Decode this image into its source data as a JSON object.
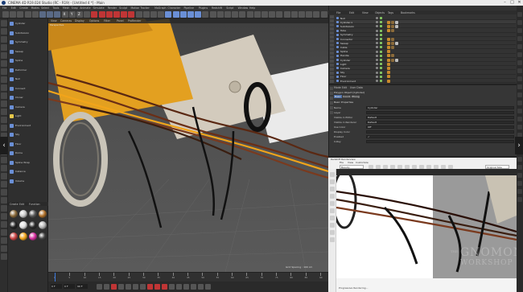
{
  "window": {
    "title": "CINEMA 4D R19.024 Studio (RC - R19) - [Untitled 4 *] - Main",
    "controls": [
      "–",
      "□",
      "✕"
    ]
  },
  "menubar": {
    "items": [
      "File",
      "Edit",
      "Create",
      "Modes",
      "Select",
      "Tools",
      "Mesh",
      "Snap",
      "Animate",
      "Simulate",
      "Render",
      "Sculpt",
      "Motion Tracker",
      "MoGraph",
      "Character",
      "Pipeline",
      "Plugins",
      "Redshift",
      "Script",
      "Window",
      "Help"
    ],
    "layout_label": "Layout:",
    "layout_value": "Startup (User)"
  },
  "toolbar": {
    "axis_labels": [
      "X",
      "Y",
      "Z"
    ]
  },
  "browser": {
    "items": [
      {
        "label": "Cylinder",
        "color": "#6a8fd6"
      },
      {
        "label": "Subdivision",
        "color": "#6a8fd6"
      },
      {
        "label": "Symmetry",
        "color": "#6a8fd6"
      },
      {
        "label": "Sweep",
        "color": "#6a8fd6"
      },
      {
        "label": "Spline",
        "color": "#6a8fd6"
      },
      {
        "label": "Deformer",
        "color": "#6a8fd6"
      },
      {
        "label": "Null",
        "color": "#6a8fd6"
      },
      {
        "label": "Connect",
        "color": "#6a8fd6"
      },
      {
        "label": "Cloner",
        "color": "#6a8fd6"
      },
      {
        "label": "Camera",
        "color": "#6a8fd6"
      },
      {
        "label": "Light",
        "color": "#e6c74a"
      },
      {
        "label": "Environment",
        "color": "#6a8fd6"
      },
      {
        "label": "Sky",
        "color": "#6a8fd6"
      },
      {
        "label": "Floor",
        "color": "#6a8fd6"
      },
      {
        "label": "Dome",
        "color": "#6a8fd6"
      },
      {
        "label": "Spline Wrap",
        "color": "#6a8fd6"
      },
      {
        "label": "Instance",
        "color": "#6a8fd6"
      },
      {
        "label": "Volume",
        "color": "#6a8fd6"
      }
    ],
    "materials_header": [
      "Create",
      "Edit",
      "Function"
    ],
    "materials": [
      {
        "color": "#8a6a3a"
      },
      {
        "color": "#c9c9c9"
      },
      {
        "color": "#5a5a5a"
      },
      {
        "color": "#b0712a"
      },
      {
        "color": "#222"
      },
      {
        "color": "#e0e0e0"
      },
      {
        "color": "#2b2b2b"
      },
      {
        "color": "#b7b7b7"
      },
      {
        "color": "#c44"
      },
      {
        "color": "#f2a51a"
      },
      {
        "color": "#d82fa0"
      },
      {
        "color": "#444"
      }
    ]
  },
  "viewport": {
    "menu": [
      "View",
      "Cameras",
      "Display",
      "Options",
      "Filter",
      "Panel",
      "ProRender"
    ],
    "perspective_label": "Perspective",
    "grid_spacing": "Grid Spacing : 100 cm",
    "colors": {
      "orange": "#e09a18",
      "beige": "#d7d0c2",
      "white": "#ececec",
      "wire": "#7a3a1e"
    }
  },
  "timeline": {
    "ticks": [
      "0",
      "5",
      "10",
      "15",
      "20",
      "25",
      "30",
      "35",
      "40",
      "45",
      "50",
      "55",
      "60",
      "65",
      "70",
      "75",
      "80",
      "85",
      "90"
    ],
    "frame_start": "0 F",
    "frame_end": "90 F",
    "current": "0 F"
  },
  "objects": {
    "tabs": [
      "File",
      "Edit",
      "View",
      "Objects",
      "Tags",
      "Bookmarks"
    ],
    "rows": [
      {
        "name": "Null",
        "tags": 0
      },
      {
        "name": "Cylinder.1",
        "tags": 3
      },
      {
        "name": "Subdivision",
        "tags": 3
      },
      {
        "name": "Tube",
        "tags": 2
      },
      {
        "name": "Symmetry",
        "tags": 0
      },
      {
        "name": "Connector",
        "tags": 2
      },
      {
        "name": "Sweep",
        "tags": 3
      },
      {
        "name": "Cable",
        "tags": 2
      },
      {
        "name": "Spline",
        "tags": 1
      },
      {
        "name": "Handle",
        "tags": 2
      },
      {
        "name": "Cylinder",
        "tags": 3
      },
      {
        "name": "Light",
        "tags": 1
      },
      {
        "name": "Camera",
        "tags": 1
      },
      {
        "name": "Sky",
        "tags": 1
      },
      {
        "name": "Floor",
        "tags": 1
      },
      {
        "name": "Environment",
        "tags": 1
      }
    ]
  },
  "attributes": {
    "tabs": [
      "Mode",
      "Edit",
      "User Data"
    ],
    "object_title": "Polygon Object [Cylinder]",
    "subtabs": [
      "Basic",
      "Coord.",
      "Phong"
    ],
    "section": "Basic Properties",
    "rows": [
      {
        "label": "Name",
        "value": "Cylinder"
      },
      {
        "label": "Layer",
        "value": ""
      },
      {
        "label": "Visible in Editor",
        "value": "Default"
      },
      {
        "label": "Visible in Renderer",
        "value": "Default"
      },
      {
        "label": "Use Color",
        "value": "Off"
      },
      {
        "label": "Display Color",
        "value": ""
      },
      {
        "label": "Enabled",
        "value": "✓"
      },
      {
        "label": "X-Ray",
        "value": ""
      }
    ]
  },
  "render_view": {
    "title": "Redshift Renderview",
    "menu": [
      "File",
      "View",
      "Customize"
    ],
    "mode": "Beauty",
    "zoom": "Original Size",
    "status": "Progressive Rendering..."
  },
  "watermark": {
    "line1": "THE",
    "line2": "GNOMON",
    "line3": "WORKSHOP"
  }
}
